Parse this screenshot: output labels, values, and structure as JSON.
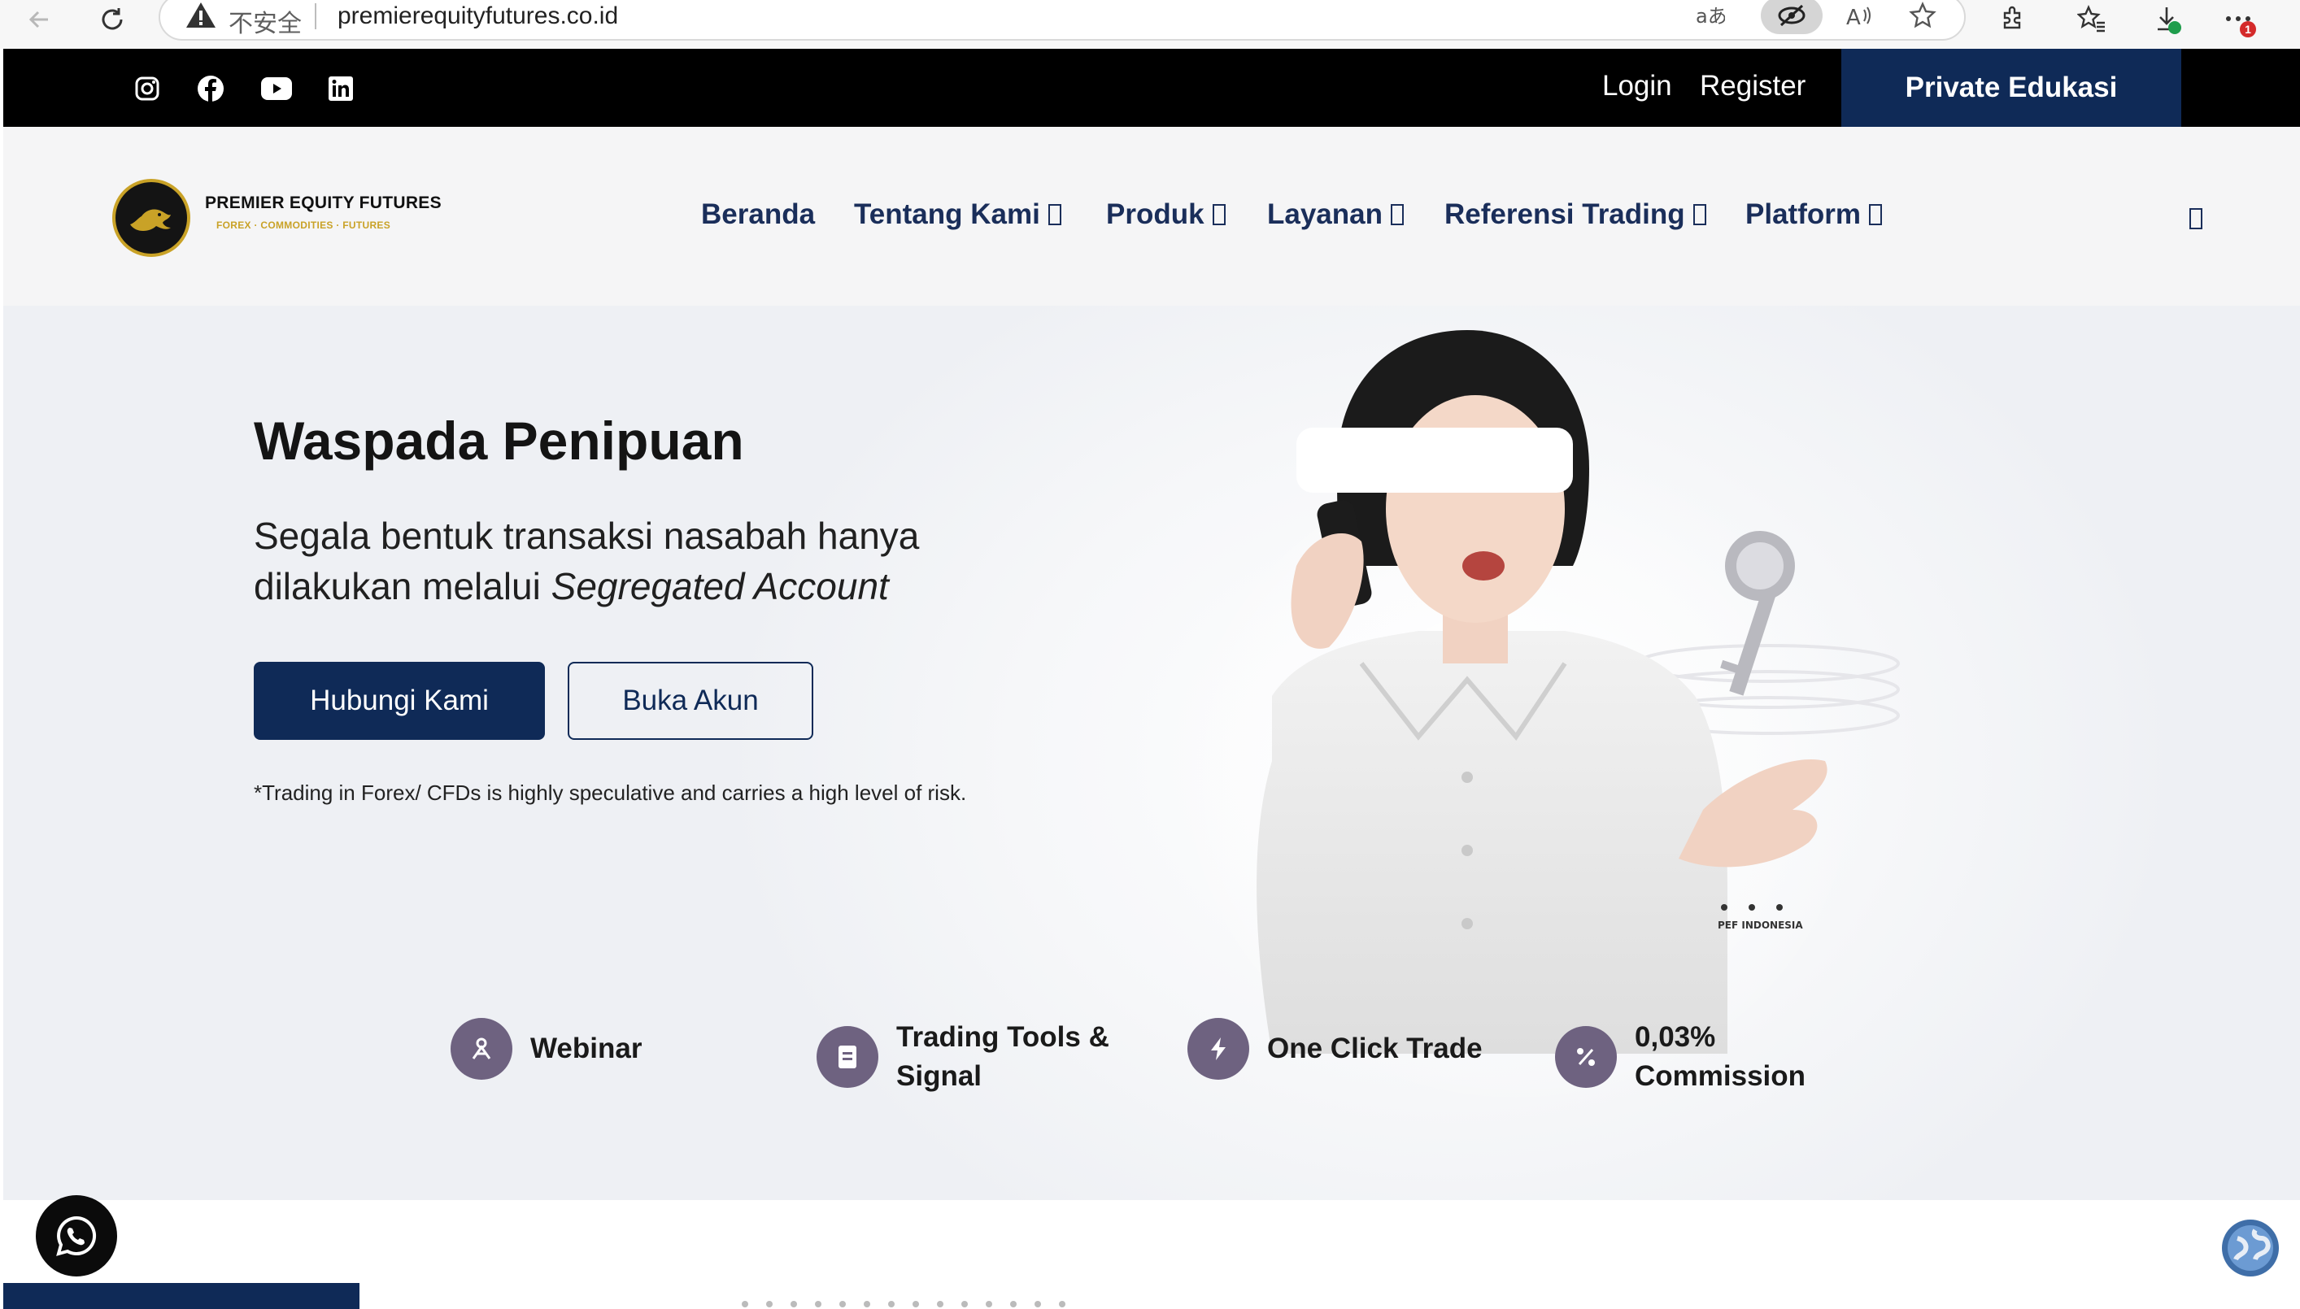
{
  "browser": {
    "security_label": "不安全",
    "url": "premierequityfutures.co.id",
    "notification_count": "1"
  },
  "topbar": {
    "social_icons": [
      "instagram-icon",
      "facebook-icon",
      "youtube-icon",
      "linkedin-icon"
    ],
    "login": "Login",
    "register": "Register",
    "cta": "Private Edukasi"
  },
  "brand": {
    "name": "PREMIER EQUITY FUTURES",
    "tagline": "FOREX · COMMODITIES · FUTURES"
  },
  "nav": {
    "items": [
      {
        "label": "Beranda"
      },
      {
        "label": "Tentang Kami"
      },
      {
        "label": "Produk"
      },
      {
        "label": "Layanan"
      },
      {
        "label": "Referensi Trading"
      },
      {
        "label": "Platform"
      }
    ]
  },
  "hero": {
    "title": "Waspada Penipuan",
    "subtitle_plain": "Segala bentuk transaksi nasabah hanya dilakukan melalui ",
    "subtitle_italic": "Segregated Account",
    "primary_button": "Hubungi Kami",
    "secondary_button": "Buka Akun",
    "disclaimer": "*Trading in Forex/ CFDs is highly speculative and carries a high level of risk.",
    "image_caption": "PEF INDONESIA"
  },
  "features": [
    {
      "label": "Webinar",
      "icon": "webinar-icon"
    },
    {
      "label": "Trading Tools & Signal",
      "icon": "document-icon"
    },
    {
      "label": "One Click Trade",
      "icon": "lightning-icon"
    },
    {
      "label": "0,03% Commission",
      "icon": "percent-icon"
    }
  ],
  "colors": {
    "navy": "#0f2a57",
    "nav_text": "#1a2e5a",
    "feature_icon_bg": "#6e6280",
    "gold": "#c9a227"
  }
}
